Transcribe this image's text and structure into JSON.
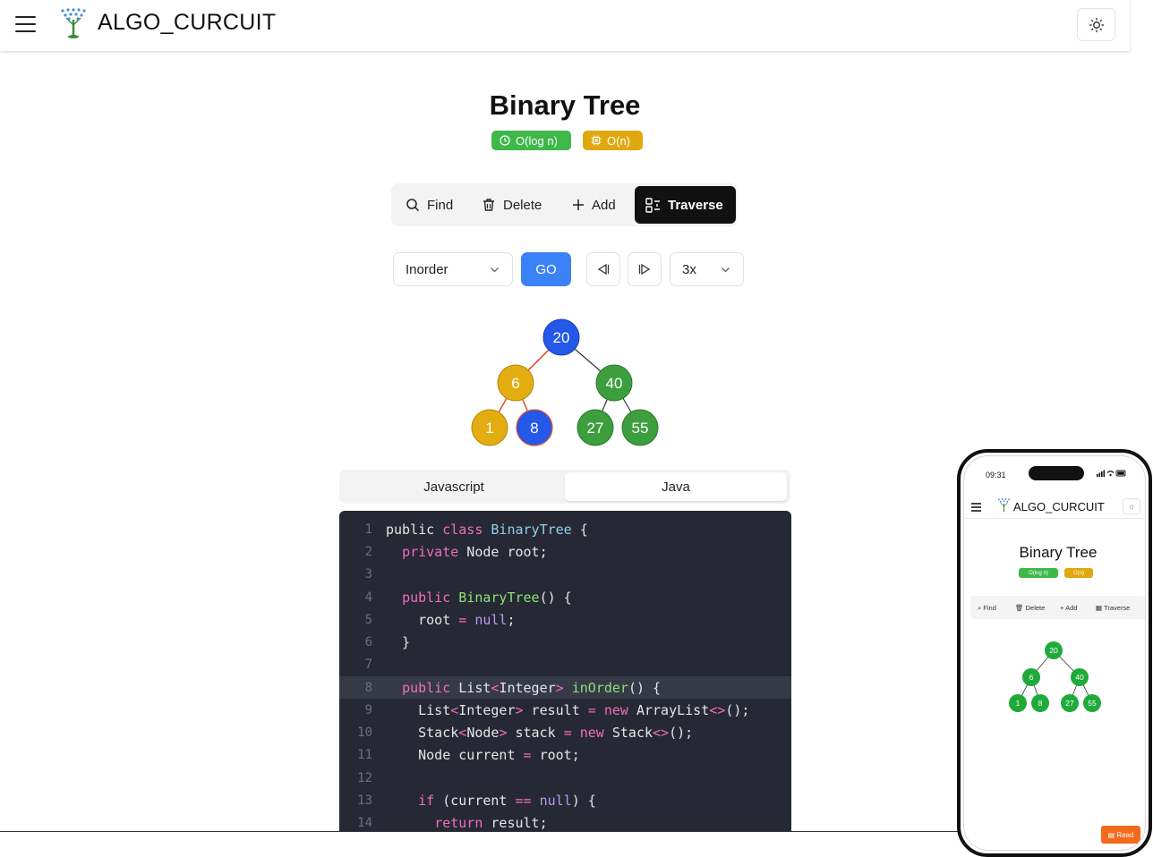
{
  "header": {
    "brand": "ALGO_CURCUIT"
  },
  "page": {
    "title": "Binary Tree",
    "time_complexity": "O(log n)",
    "space_complexity": "O(n)"
  },
  "operations": {
    "find": "Find",
    "delete": "Delete",
    "add": "Add",
    "traverse": "Traverse"
  },
  "controls": {
    "order": "Inorder",
    "go": "GO",
    "speed": "3x"
  },
  "tree": {
    "root": "20",
    "l": "6",
    "r": "40",
    "ll": "1",
    "lr": "8",
    "rl": "27",
    "rr": "55"
  },
  "code_tabs": {
    "javascript": "Javascript",
    "java": "Java"
  },
  "code_line_numbers": [
    "1",
    "2",
    "3",
    "4",
    "5",
    "6",
    "7",
    "8",
    "9",
    "10",
    "11",
    "12",
    "13",
    "14"
  ],
  "code_raw": [
    "public class BinaryTree {",
    "  private Node root;",
    "",
    "  public BinaryTree() {",
    "    root = null;",
    "  }",
    "",
    "  public List<Integer> inOrder() {",
    "    List<Integer> result = new ArrayList<>();",
    "    Stack<Node> stack = new Stack<>();",
    "    Node current = root;",
    "",
    "    if (current == null) {",
    "      return result;"
  ],
  "colors": {
    "visited_node": "#2458e8",
    "path_node": "#e3ad12",
    "default_node": "#3d9e3d",
    "go_button": "#3b82f6",
    "code_background": "#262833"
  },
  "phone": {
    "time": "09:31",
    "brand": "ALGO_CURCUIT",
    "title": "Binary Tree",
    "time_complexity": "O(log n)",
    "space_complexity": "O(n)",
    "ops": {
      "find": "Find",
      "delete": "Delete",
      "add": "Add",
      "traverse": "Traverse"
    },
    "tree": {
      "root": "20",
      "l": "6",
      "r": "40",
      "ll": "1",
      "lr": "8",
      "rl": "27",
      "rr": "55"
    },
    "read_button": "Read"
  }
}
